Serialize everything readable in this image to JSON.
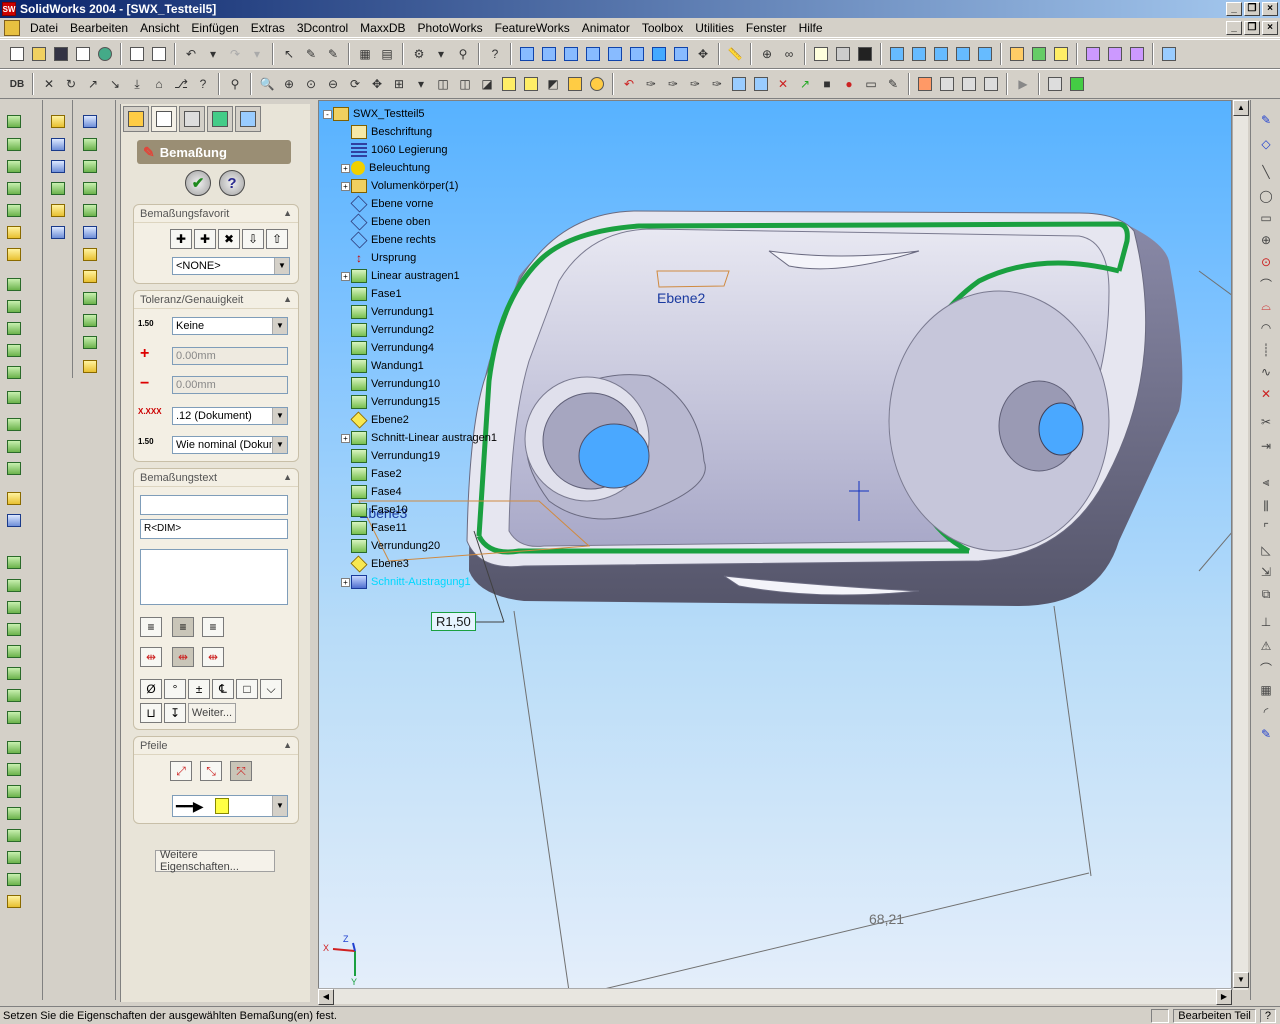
{
  "window": {
    "title": "SolidWorks 2004 - [SWX_Testteil5]",
    "app_icon_text": "SW"
  },
  "menu": [
    "Datei",
    "Bearbeiten",
    "Ansicht",
    "Einfügen",
    "Extras",
    "3Dcontrol",
    "MaxxDB",
    "PhotoWorks",
    "FeatureWorks",
    "Animator",
    "Toolbox",
    "Utilities",
    "Fenster",
    "Hilfe"
  ],
  "property_manager": {
    "title": "Bemaßung",
    "groups": {
      "favorite": {
        "title": "Bemaßungsfavorit",
        "combo_value": "<NONE>"
      },
      "tolerance": {
        "title": "Toleranz/Genauigkeit",
        "tolerance_type": "Keine",
        "plus_value": "0.00mm",
        "minus_value": "0.00mm",
        "precision": ".12 (Dokument)",
        "tolerance_precision": "Wie nominal (Dokum",
        "icon_tol_label": "1.50",
        "icon_prec_label": "X.XXX"
      },
      "text": {
        "title": "Bemaßungstext",
        "line1": "",
        "line2": "R<DIM>",
        "line3": "",
        "more_label": "Weiter..."
      },
      "arrows": {
        "title": "Pfeile"
      }
    },
    "more_properties_label": "Weitere Eigenschaften..."
  },
  "feature_tree": [
    {
      "label": "SWX_Testteil5",
      "icon": "part-icon",
      "expand": "-"
    },
    {
      "label": "Beschriftung",
      "icon": "annotations-icon",
      "expand": ""
    },
    {
      "label": "1060 Legierung",
      "icon": "material-icon",
      "expand": ""
    },
    {
      "label": "Beleuchtung",
      "icon": "lighting-icon",
      "expand": "+"
    },
    {
      "label": "Volumenkörper(1)",
      "icon": "solid-bodies-icon",
      "expand": "+"
    },
    {
      "label": "Ebene vorne",
      "icon": "plane-icon",
      "expand": ""
    },
    {
      "label": "Ebene oben",
      "icon": "plane-icon",
      "expand": ""
    },
    {
      "label": "Ebene rechts",
      "icon": "plane-icon",
      "expand": ""
    },
    {
      "label": "Ursprung",
      "icon": "origin-icon",
      "expand": ""
    },
    {
      "label": "Linear austragen1",
      "icon": "extrude-icon",
      "expand": "+"
    },
    {
      "label": "Fase1",
      "icon": "chamfer-icon",
      "expand": ""
    },
    {
      "label": "Verrundung1",
      "icon": "fillet-icon",
      "expand": ""
    },
    {
      "label": "Verrundung2",
      "icon": "fillet-icon",
      "expand": ""
    },
    {
      "label": "Verrundung4",
      "icon": "fillet-icon",
      "expand": ""
    },
    {
      "label": "Wandung1",
      "icon": "shell-icon",
      "expand": ""
    },
    {
      "label": "Verrundung10",
      "icon": "fillet-icon",
      "expand": ""
    },
    {
      "label": "Verrundung15",
      "icon": "fillet-icon",
      "expand": ""
    },
    {
      "label": "Ebene2",
      "icon": "ref-plane-icon",
      "expand": ""
    },
    {
      "label": "Schnitt-Linear austragen1",
      "icon": "cut-extrude-icon",
      "expand": "+"
    },
    {
      "label": "Verrundung19",
      "icon": "fillet-icon",
      "expand": ""
    },
    {
      "label": "Fase2",
      "icon": "chamfer-icon",
      "expand": ""
    },
    {
      "label": "Fase4",
      "icon": "chamfer-icon",
      "expand": ""
    },
    {
      "label": "Fase10",
      "icon": "chamfer-icon",
      "expand": ""
    },
    {
      "label": "Fase11",
      "icon": "chamfer-icon",
      "expand": ""
    },
    {
      "label": "Verrundung20",
      "icon": "fillet-icon",
      "expand": ""
    },
    {
      "label": "Ebene3",
      "icon": "ref-plane-icon",
      "expand": ""
    },
    {
      "label": "Schnitt-Austragung1",
      "icon": "cut-sweep-icon",
      "expand": "+",
      "highlight": true
    }
  ],
  "viewport": {
    "plane_label_1": "Ebene2",
    "plane_label_2": "Ebene3",
    "radius_dim": "R1,50",
    "linear_dim": "68,21",
    "triad_x": "X",
    "triad_y": "Y",
    "triad_z": "Z"
  },
  "statusbar": {
    "message": "Setzen Sie die Eigenschaften der ausgewählten Bemaßung(en) fest.",
    "mode": "Bearbeiten Teil",
    "help": "?"
  },
  "colors": {
    "viewport_top": "#57b2ff",
    "viewport_bottom": "#e4eefa",
    "highlight_green": "#1aa040",
    "part_body": "#a8a8c8",
    "dimension_box": "#1aa040"
  }
}
